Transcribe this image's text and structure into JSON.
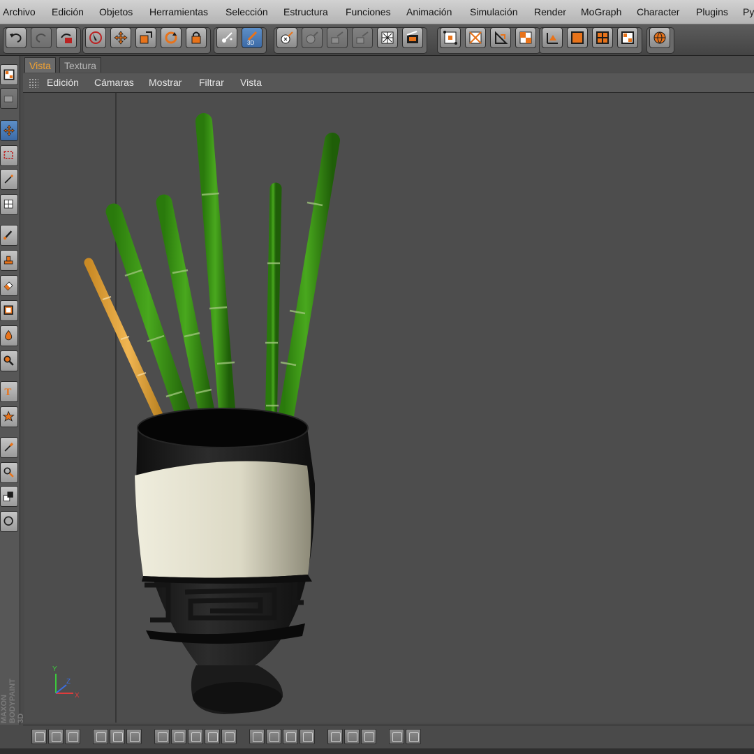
{
  "menubar": {
    "items": [
      "Archivo",
      "Edición",
      "Objetos",
      "Herramientas",
      "Selección",
      "Estructura",
      "Funciones",
      "Animación",
      "Simulación",
      "Render",
      "MoGraph",
      "Character",
      "Plugins",
      "Py"
    ]
  },
  "toolbar": {
    "buttons": [
      {
        "name": "undo-button",
        "icon": "undo-icon",
        "state": "normal"
      },
      {
        "name": "redo-button",
        "icon": "redo-icon",
        "state": "dim"
      },
      {
        "name": "undo-view-button",
        "icon": "undo-view-icon",
        "state": "normal"
      },
      {
        "name": "live-selection-button",
        "icon": "live-selection-icon",
        "state": "normal"
      },
      {
        "name": "move-button",
        "icon": "move-icon",
        "state": "normal"
      },
      {
        "name": "scale-button",
        "icon": "scale-icon",
        "state": "normal"
      },
      {
        "name": "rotate-button",
        "icon": "rotate-icon",
        "state": "normal"
      },
      {
        "name": "lock-axis-button",
        "icon": "lock-icon",
        "state": "normal"
      },
      {
        "name": "paint-setup-button",
        "icon": "paint-setup-icon",
        "state": "normal"
      },
      {
        "name": "paint-3d-button",
        "icon": "brush-3d-icon",
        "state": "active",
        "label": "3D"
      },
      {
        "name": "material-paint-button",
        "icon": "sphere-brush-icon",
        "state": "normal"
      },
      {
        "name": "projection-paint-button",
        "icon": "projection-icon",
        "state": "dim"
      },
      {
        "name": "texture-paint-button",
        "icon": "texture-paint-icon",
        "state": "dim"
      },
      {
        "name": "object-paint-button",
        "icon": "object-paint-icon",
        "state": "dim"
      },
      {
        "name": "texture-view-button",
        "icon": "texture-grid-icon",
        "state": "normal"
      },
      {
        "name": "render-button",
        "icon": "clapper-icon",
        "state": "normal"
      },
      {
        "name": "uv-points-button",
        "icon": "uv-points-icon",
        "state": "normal"
      },
      {
        "name": "uv-polygons-button",
        "icon": "uv-polygons-icon",
        "state": "normal"
      },
      {
        "name": "uv-edit-button",
        "icon": "uv-edit-icon",
        "state": "normal"
      },
      {
        "name": "uv-checker-button",
        "icon": "checker-icon",
        "state": "normal"
      },
      {
        "name": "axis-mode-button",
        "icon": "axis-icon",
        "state": "normal"
      },
      {
        "name": "single-view-button",
        "icon": "single-view-icon",
        "state": "normal"
      },
      {
        "name": "quad-view-button",
        "icon": "quad-view-icon",
        "state": "normal"
      },
      {
        "name": "layout-view-button",
        "icon": "layout-icon",
        "state": "normal"
      },
      {
        "name": "render-globe-button",
        "icon": "globe-icon",
        "state": "normal"
      }
    ]
  },
  "left_tools": [
    {
      "name": "layout-tool",
      "icon": "layout-icon",
      "state": "normal"
    },
    {
      "name": "camera-tool",
      "icon": "camera-icon",
      "state": "dim"
    },
    {
      "name": "move-tool",
      "icon": "move-icon",
      "state": "active"
    },
    {
      "name": "rect-selection-tool",
      "icon": "rect-selection-icon",
      "state": "normal"
    },
    {
      "name": "magic-wand-tool",
      "icon": "magic-wand-icon",
      "state": "normal"
    },
    {
      "name": "transform-tool",
      "icon": "transform-icon",
      "state": "normal"
    },
    {
      "name": "brush-tool",
      "icon": "brush-icon",
      "state": "normal"
    },
    {
      "name": "stamp-tool",
      "icon": "stamp-icon",
      "state": "normal"
    },
    {
      "name": "eraser-tool",
      "icon": "eraser-icon",
      "state": "normal"
    },
    {
      "name": "fill-tool",
      "icon": "fill-icon",
      "state": "normal"
    },
    {
      "name": "smudge-tool",
      "icon": "drop-icon",
      "state": "normal"
    },
    {
      "name": "zoom-tool",
      "icon": "magnifier-icon",
      "state": "normal"
    },
    {
      "name": "text-tool",
      "icon": "text-icon",
      "state": "normal"
    },
    {
      "name": "shape-tool",
      "icon": "star-icon",
      "state": "normal"
    },
    {
      "name": "eyedropper-tool",
      "icon": "eyedropper-icon",
      "state": "normal"
    },
    {
      "name": "color-picker-tool",
      "icon": "color-picker-icon",
      "state": "normal"
    },
    {
      "name": "color-swatches",
      "icon": "swatch-icon",
      "state": "normal"
    },
    {
      "name": "quick-mask-tool",
      "icon": "mask-icon",
      "state": "normal"
    }
  ],
  "brand": {
    "line1": "MAXON",
    "line2": "BODYPAINT 3D"
  },
  "tabs": [
    {
      "label": "Vista",
      "active": true
    },
    {
      "label": "Textura",
      "active": false
    }
  ],
  "view_menu": [
    "Edición",
    "Cámaras",
    "Mostrar",
    "Filtrar",
    "Vista"
  ],
  "axis": {
    "y": "Y",
    "x": "X",
    "z": "Z"
  },
  "colors": {
    "accent_tab": "#f2a232",
    "viewport_bg": "#4d4d4d",
    "bamboo_green": "#2f8a10",
    "bamboo_yellow": "#e0a23a",
    "vase_black": "#1e1e1e",
    "vase_band": "#dedbc8"
  },
  "bottom_toolbar": {
    "groups": [
      3,
      3,
      5,
      4,
      3,
      2
    ]
  }
}
